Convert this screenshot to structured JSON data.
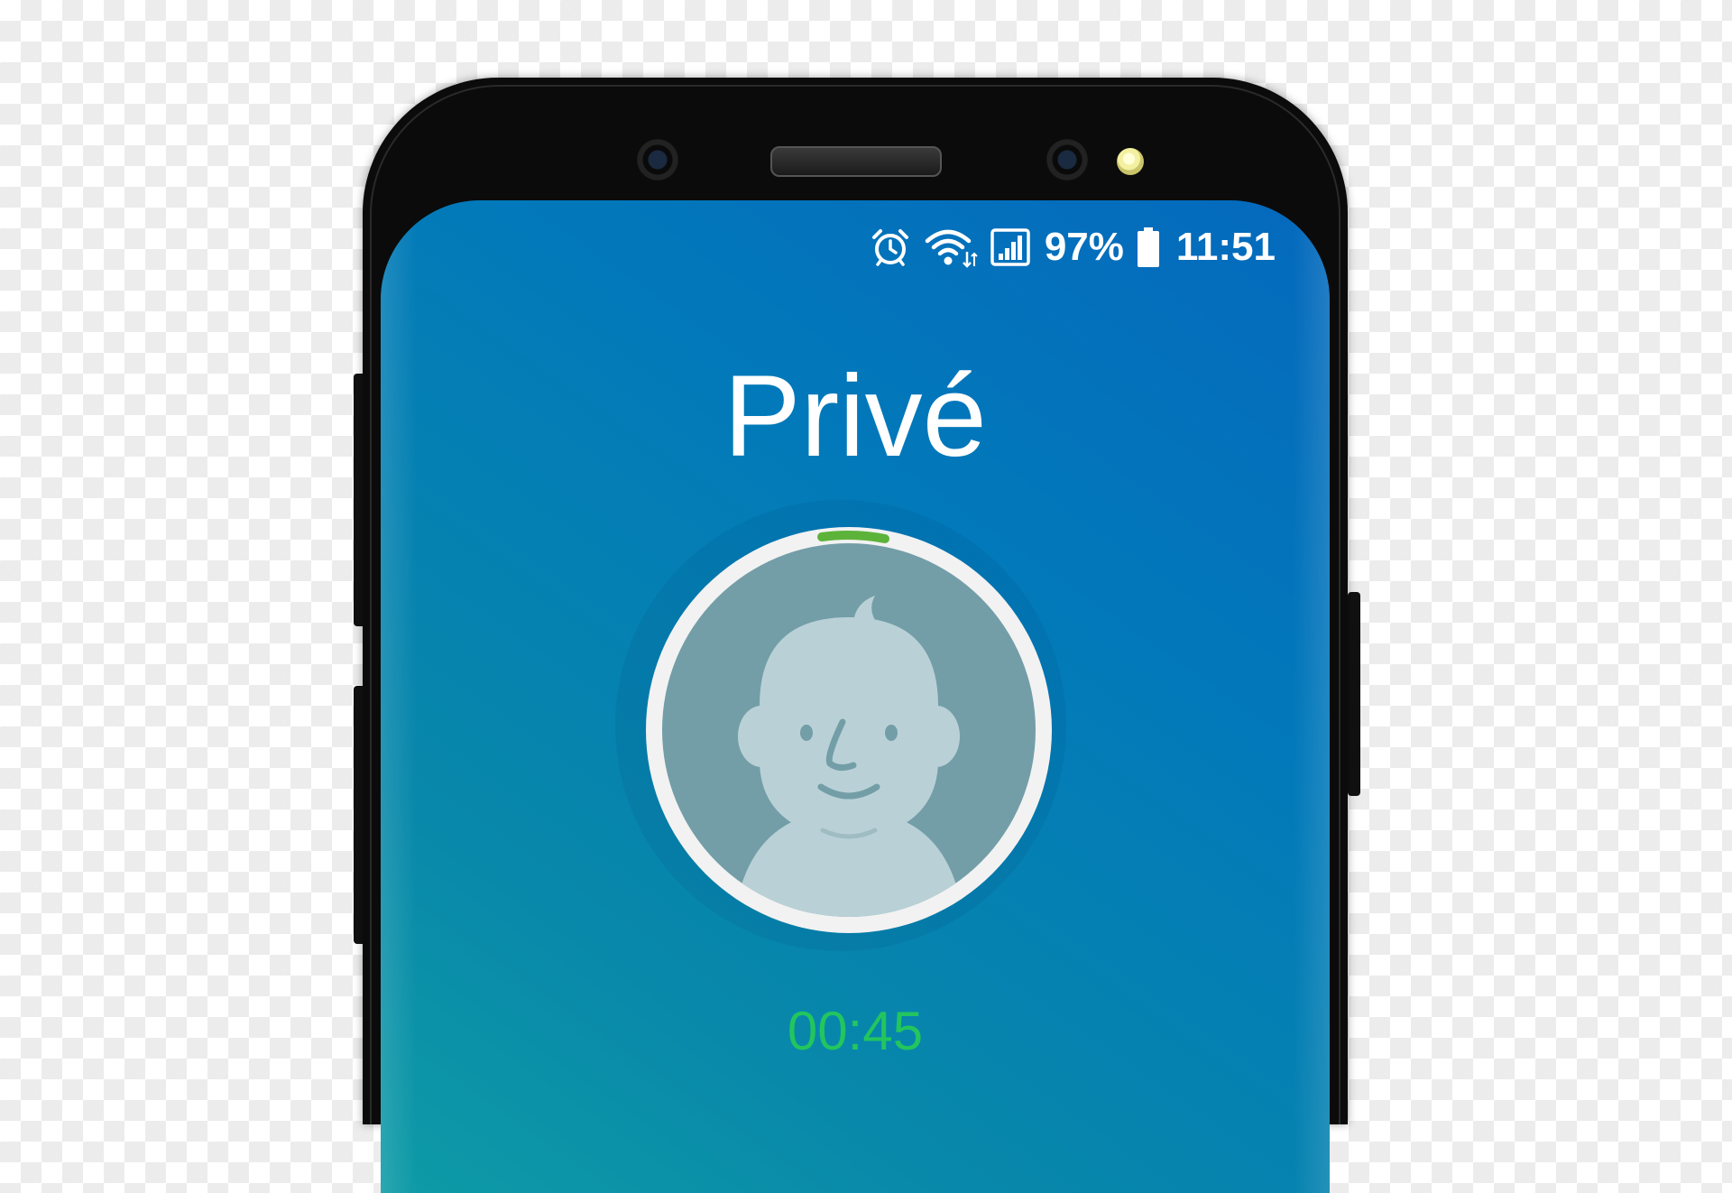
{
  "status_bar": {
    "alarm_icon": "alarm-clock-icon",
    "wifi_icon": "wifi-icon",
    "signal_icon": "cell-signal-icon",
    "battery_percent": "97%",
    "battery_level": 0.97,
    "battery_icon": "battery-icon",
    "time": "11:51"
  },
  "call": {
    "caller_name": "Privé",
    "avatar_icon": "default-contact-avatar-icon",
    "duration": "00:45",
    "progress_color": "#5db33a",
    "timer_color": "#22c55e"
  },
  "colors": {
    "screen_gradient_top": "#0569bd",
    "screen_gradient_bottom": "#0e9ba6",
    "avatar_background": "#739ea8",
    "avatar_face": "#b9d1d6"
  }
}
